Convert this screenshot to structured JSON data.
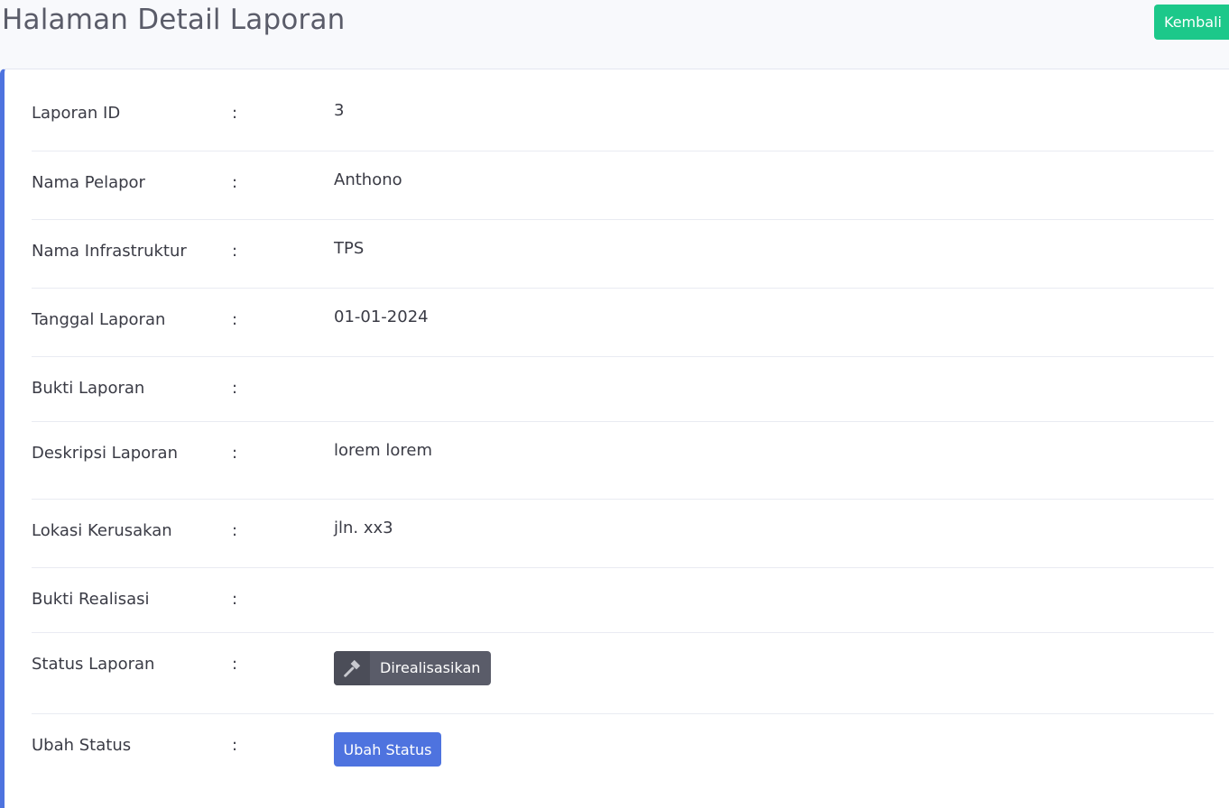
{
  "header": {
    "title": "Halaman Detail Laporan",
    "back_label": "Kembali"
  },
  "colors": {
    "back_button": "#1cc88a",
    "card_accent": "#4e73df",
    "status_badge": "#5a5c69",
    "ubah_button": "#4e73df"
  },
  "separator": ":",
  "fields": [
    {
      "label": "Laporan ID",
      "value": "3"
    },
    {
      "label": "Nama Pelapor",
      "value": "Anthono"
    },
    {
      "label": "Nama Infrastruktur",
      "value": "TPS"
    },
    {
      "label": "Tanggal Laporan",
      "value": "01-01-2024"
    },
    {
      "label": "Bukti Laporan",
      "value": ""
    },
    {
      "label": "Deskripsi Laporan",
      "value": "lorem lorem"
    },
    {
      "label": "Lokasi Kerusakan",
      "value": "jln. xx3"
    },
    {
      "label": "Bukti Realisasi",
      "value": ""
    },
    {
      "label": "Status Laporan",
      "badge_icon": "hammer-icon",
      "badge_text": "Direalisasikan"
    },
    {
      "label": "Ubah Status",
      "button_label": "Ubah Status"
    }
  ]
}
